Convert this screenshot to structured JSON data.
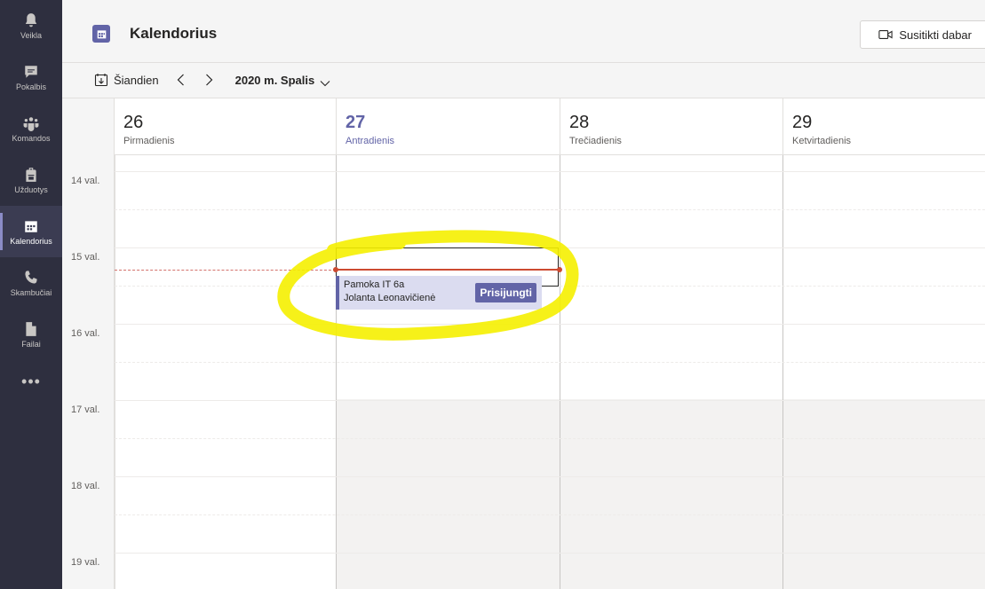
{
  "rail": {
    "items": [
      {
        "label": "Veikla",
        "icon": "bell-icon",
        "active": false
      },
      {
        "label": "Pokalbis",
        "icon": "chat-icon",
        "active": false
      },
      {
        "label": "Komandos",
        "icon": "teams-icon",
        "active": false
      },
      {
        "label": "Užduotys",
        "icon": "backpack-icon",
        "active": false
      },
      {
        "label": "Kalendorius",
        "icon": "calendar-icon",
        "active": true
      },
      {
        "label": "Skambučiai",
        "icon": "phone-icon",
        "active": false
      },
      {
        "label": "Failai",
        "icon": "file-icon",
        "active": false
      }
    ],
    "more": "•••"
  },
  "header": {
    "title": "Kalendorius",
    "meet_now": "Susitikti dabar"
  },
  "toolbar": {
    "today": "Šiandien",
    "month": "2020 m. Spalis"
  },
  "days": [
    {
      "num": "26",
      "name": "Pirmadienis",
      "today": false
    },
    {
      "num": "27",
      "name": "Antradienis",
      "today": true
    },
    {
      "num": "28",
      "name": "Trečiadienis",
      "today": false
    },
    {
      "num": "29",
      "name": "Ketvirtadienis",
      "today": false
    }
  ],
  "hours": [
    "14 val.",
    "15 val.",
    "16 val.",
    "17 val.",
    "18 val.",
    "19 val."
  ],
  "event": {
    "title": "Pamoka IT 6a",
    "organizer": "Jolanta Leonavičienė",
    "join": "Prisijungti"
  },
  "colors": {
    "accent": "#6264a7",
    "rail": "#2e2f3f",
    "now_line": "#cc4a31",
    "highlight": "#f5f000"
  }
}
